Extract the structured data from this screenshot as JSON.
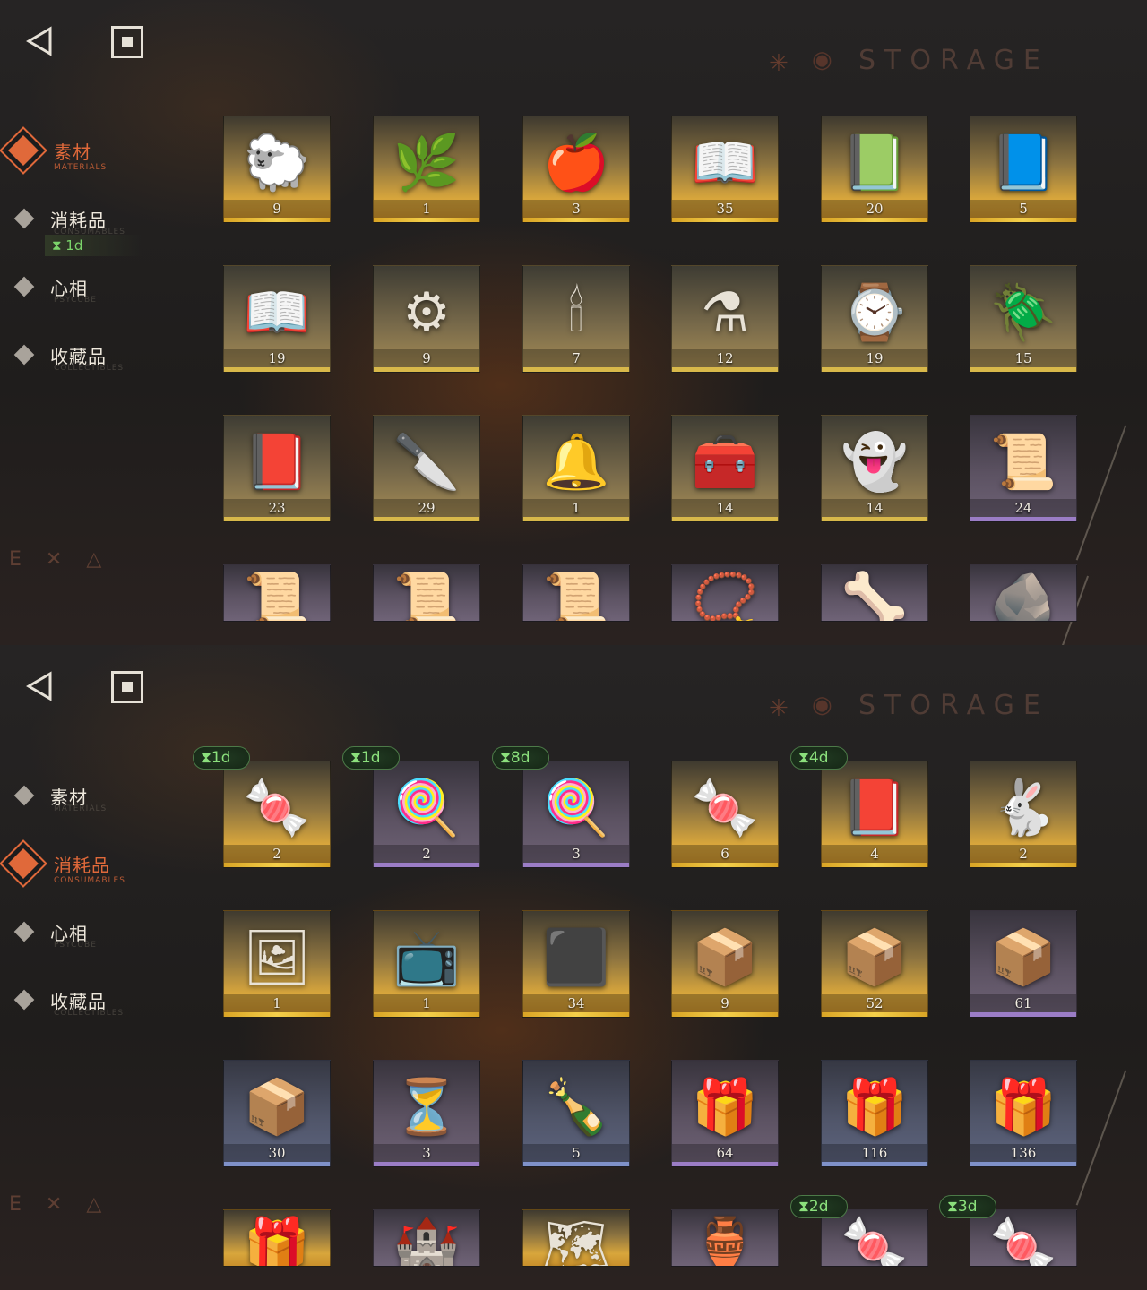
{
  "panels": [
    {
      "storage_title": "STORAGE",
      "categories": [
        {
          "label": "素材",
          "sub": "MATERIALS",
          "active": true
        },
        {
          "label": "消耗品",
          "sub": "CONSUMABLES",
          "active": false
        },
        {
          "label": "心相",
          "sub": "PSYCUBE",
          "active": false
        },
        {
          "label": "收藏品",
          "sub": "COLLECTIBLES",
          "active": false
        }
      ],
      "category_timer": "⧗ 1d",
      "items": [
        {
          "icon": "golden-sheep-icon",
          "glyph": "🐑",
          "count": "9",
          "rarity": "gold"
        },
        {
          "icon": "laurel-wreath-icon",
          "glyph": "🌿",
          "count": "1",
          "rarity": "gold"
        },
        {
          "icon": "apple-snake-icon",
          "glyph": "🍎",
          "count": "3",
          "rarity": "gold"
        },
        {
          "icon": "red-rune-book-icon",
          "glyph": "📖",
          "count": "35",
          "rarity": "gold"
        },
        {
          "icon": "green-rune-book-icon",
          "glyph": "📗",
          "count": "20",
          "rarity": "gold"
        },
        {
          "icon": "blue-rune-book-icon",
          "glyph": "📘",
          "count": "5",
          "rarity": "gold"
        },
        {
          "icon": "gold-rune-book-icon",
          "glyph": "📖",
          "count": "19",
          "rarity": "olive"
        },
        {
          "icon": "clockwork-astrolabe-icon",
          "glyph": "⚙",
          "count": "9",
          "rarity": "olive"
        },
        {
          "icon": "ouija-board-icon",
          "glyph": "🕯",
          "count": "7",
          "rarity": "olive"
        },
        {
          "icon": "potion-bottle-icon",
          "glyph": "⚗",
          "count": "12",
          "rarity": "olive"
        },
        {
          "icon": "silver-watch-icon",
          "glyph": "⌚",
          "count": "19",
          "rarity": "olive"
        },
        {
          "icon": "firefly-icon",
          "glyph": "🪲",
          "count": "15",
          "rarity": "olive"
        },
        {
          "icon": "dark-tome-icon",
          "glyph": "📕",
          "count": "23",
          "rarity": "olive"
        },
        {
          "icon": "silver-bullets-icon",
          "glyph": "🔪",
          "count": "29",
          "rarity": "olive"
        },
        {
          "icon": "bell-jar-icon",
          "glyph": "🔔",
          "count": "1",
          "rarity": "olive"
        },
        {
          "icon": "hand-chest-icon",
          "glyph": "🧰",
          "count": "14",
          "rarity": "olive"
        },
        {
          "icon": "ghost-icon",
          "glyph": "👻",
          "count": "14",
          "rarity": "olive"
        },
        {
          "icon": "red-rune-scroll-icon",
          "glyph": "📜",
          "count": "24",
          "rarity": "purple"
        },
        {
          "icon": "green-rune-scroll-icon",
          "glyph": "📜",
          "count": "",
          "rarity": "purple"
        },
        {
          "icon": "blue-rune-scroll-icon",
          "glyph": "📜",
          "count": "",
          "rarity": "purple"
        },
        {
          "icon": "gold-rune-scroll-icon",
          "glyph": "📜",
          "count": "",
          "rarity": "purple"
        },
        {
          "icon": "pendant-icon",
          "glyph": "📿",
          "count": "",
          "rarity": "purple"
        },
        {
          "icon": "horn-icon",
          "glyph": "🦴",
          "count": "",
          "rarity": "purple"
        },
        {
          "icon": "stone-tablet-icon",
          "glyph": "🪨",
          "count": "",
          "rarity": "purple"
        }
      ],
      "badges": []
    },
    {
      "storage_title": "STORAGE",
      "categories": [
        {
          "label": "素材",
          "sub": "MATERIALS",
          "active": false
        },
        {
          "label": "消耗品",
          "sub": "CONSUMABLES",
          "active": true
        },
        {
          "label": "心相",
          "sub": "PSYCUBE",
          "active": false
        },
        {
          "label": "收藏品",
          "sub": "COLLECTIBLES",
          "active": false
        }
      ],
      "items": [
        {
          "icon": "candy-jar-icon",
          "glyph": "🍬",
          "count": "2",
          "rarity": "gold",
          "timer": "⧗1d"
        },
        {
          "icon": "lollipops-icon",
          "glyph": "🍭",
          "count": "2",
          "rarity": "purple",
          "timer": "⧗1d"
        },
        {
          "icon": "lollipops-icon",
          "glyph": "🍭",
          "count": "3",
          "rarity": "purple",
          "timer": "⧗8d"
        },
        {
          "icon": "candy-jar-icon",
          "glyph": "🍬",
          "count": "6",
          "rarity": "gold",
          "timer": ""
        },
        {
          "icon": "red-manual-icon",
          "glyph": "📕",
          "count": "4",
          "rarity": "gold",
          "timer": "⧗4d"
        },
        {
          "icon": "rabbit-box-icon",
          "glyph": "🐇",
          "count": "2",
          "rarity": "gold",
          "timer": ""
        },
        {
          "icon": "photo-box-icon",
          "glyph": "🖼",
          "count": "1",
          "rarity": "gold",
          "timer": ""
        },
        {
          "icon": "old-tv-icon",
          "glyph": "📺",
          "count": "1",
          "rarity": "gold",
          "timer": ""
        },
        {
          "icon": "rune-table-icon",
          "glyph": "⬛",
          "count": "34",
          "rarity": "gold",
          "timer": ""
        },
        {
          "icon": "wooden-crate-icon",
          "glyph": "📦",
          "count": "9",
          "rarity": "gold",
          "timer": ""
        },
        {
          "icon": "wooden-crate-icon",
          "glyph": "📦",
          "count": "52",
          "rarity": "gold",
          "timer": ""
        },
        {
          "icon": "wooden-crate-icon",
          "glyph": "📦",
          "count": "61",
          "rarity": "purple",
          "timer": ""
        },
        {
          "icon": "wooden-crate-icon",
          "glyph": "📦",
          "count": "30",
          "rarity": "blue",
          "timer": ""
        },
        {
          "icon": "hourglass-icon",
          "glyph": "⏳",
          "count": "3",
          "rarity": "purple",
          "timer": ""
        },
        {
          "icon": "bottle-icon",
          "glyph": "🍾",
          "count": "5",
          "rarity": "blue",
          "timer": ""
        },
        {
          "icon": "parcel-icon",
          "glyph": "🎁",
          "count": "64",
          "rarity": "purple",
          "timer": ""
        },
        {
          "icon": "parcel-icon",
          "glyph": "🎁",
          "count": "116",
          "rarity": "blue",
          "timer": ""
        },
        {
          "icon": "parcel-icon",
          "glyph": "🎁",
          "count": "136",
          "rarity": "blue",
          "timer": ""
        },
        {
          "icon": "parcel-icon",
          "glyph": "🎁",
          "count": "",
          "rarity": "gold",
          "timer": ""
        },
        {
          "icon": "sand-castle-icon",
          "glyph": "🏰",
          "count": "",
          "rarity": "purple",
          "timer": ""
        },
        {
          "icon": "map-chest-icon",
          "glyph": "🗺",
          "count": "",
          "rarity": "gold",
          "timer": ""
        },
        {
          "icon": "ornament-icon",
          "glyph": "🏺",
          "count": "",
          "rarity": "purple",
          "timer": ""
        },
        {
          "icon": "candies-icon",
          "glyph": "🍬",
          "count": "",
          "rarity": "purple",
          "timer": "⧗2d"
        },
        {
          "icon": "candies-icon",
          "glyph": "🍬",
          "count": "",
          "rarity": "purple",
          "timer": "⧗3d"
        }
      ]
    }
  ],
  "colors": {
    "accent": "#e0693a",
    "timer_green": "#8be07c",
    "gold": "#f4cf4a",
    "purple": "#9b7dc6",
    "blue": "#7f91c9"
  }
}
